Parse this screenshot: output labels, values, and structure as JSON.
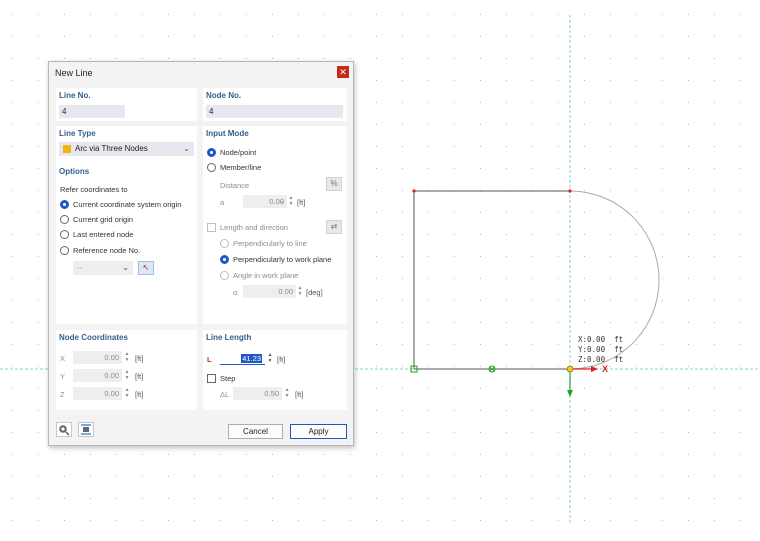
{
  "dialog": {
    "title": "New Line",
    "close_icon": "close-icon",
    "line_no": {
      "label": "Line No.",
      "value": "4"
    },
    "node_no": {
      "label": "Node No.",
      "value": "4"
    },
    "line_type": {
      "label": "Line Type",
      "value": "Arc via Three Nodes",
      "swatch_color": "#f2b50a"
    },
    "options": {
      "label": "Options",
      "refer_label": "Refer coordinates to",
      "choices": [
        "Current coordinate system origin",
        "Current grid origin",
        "Last entered node",
        "Reference node No."
      ],
      "selected_index": 0,
      "ref_node_value": "--"
    },
    "input_mode": {
      "label": "Input Mode",
      "node_point": "Node/point",
      "member_line": "Member/line",
      "selected": "Node/point",
      "distance_label": "Distance",
      "a_label": "a",
      "a_value": "0.00",
      "a_unit": "[ft]",
      "length_direction": "Length and direction",
      "perp_line": "Perpendicularly to line",
      "perp_work_plane": "Perpendicularly to work plane",
      "angle_work_plane": "Angle in work plane",
      "alpha_label": "α",
      "alpha_value": "0.00",
      "alpha_unit": "[deg]"
    },
    "node_coordinates": {
      "label": "Node Coordinates",
      "rows": [
        {
          "axis": "X",
          "value": "0.00",
          "unit": "[ft]"
        },
        {
          "axis": "Y",
          "value": "0.00",
          "unit": "[ft]"
        },
        {
          "axis": "Z",
          "value": "0.00",
          "unit": "[ft]"
        }
      ]
    },
    "line_length": {
      "label": "Line Length",
      "l_label": "L",
      "l_value": "41.23",
      "l_unit": "[ft]",
      "step_label": "Step",
      "delta_label": "ΔL",
      "delta_value": "0.50",
      "delta_unit": "[ft]"
    },
    "footer": {
      "cancel": "Cancel",
      "apply": "Apply",
      "tool1_icon": "search-settings-icon",
      "tool2_icon": "distribute-icon"
    }
  },
  "viewport": {
    "coord_readout": "X:0.00  ft\nY:0.00  ft\nZ:0.00  ft",
    "x_axis_label": "X",
    "x_axis_color": "#e02020",
    "z_axis_color": "#1aa51a",
    "guide_color": "#7fd3c5",
    "line_color": "#555555",
    "arc_color": "#aaaaaa",
    "node_color": "#e02020"
  }
}
